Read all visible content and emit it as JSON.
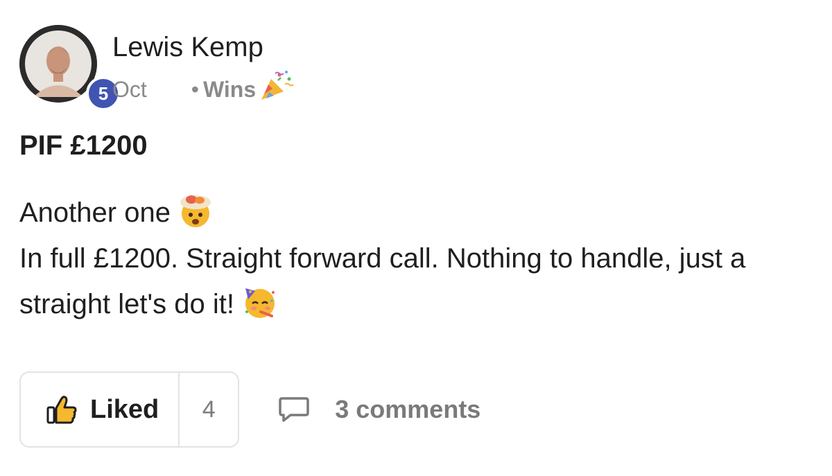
{
  "post": {
    "author": {
      "name": "Lewis Kemp",
      "level": "5"
    },
    "meta": {
      "date": "Oct",
      "separator": "•",
      "category": "Wins",
      "category_icon": "party-popper-icon"
    },
    "title": "PIF £1200",
    "body": {
      "line1": "Another one",
      "line1_icon": "exploding-head-emoji",
      "line2": "In full £1200. Straight forward call. Nothing to handle, just a straight let's do it!",
      "line2_icon": "partying-face-emoji"
    }
  },
  "actions": {
    "like_label": "Liked",
    "like_icon": "thumbs-up-icon",
    "like_count": "4",
    "comments_label": "3 comments",
    "comments_icon": "comment-bubble-icon"
  },
  "colors": {
    "badge": "#4054b2",
    "text": "#1f1f1f",
    "muted": "#8a8a8a",
    "border": "#e3e3e3",
    "thumb": "#f5b82e"
  }
}
